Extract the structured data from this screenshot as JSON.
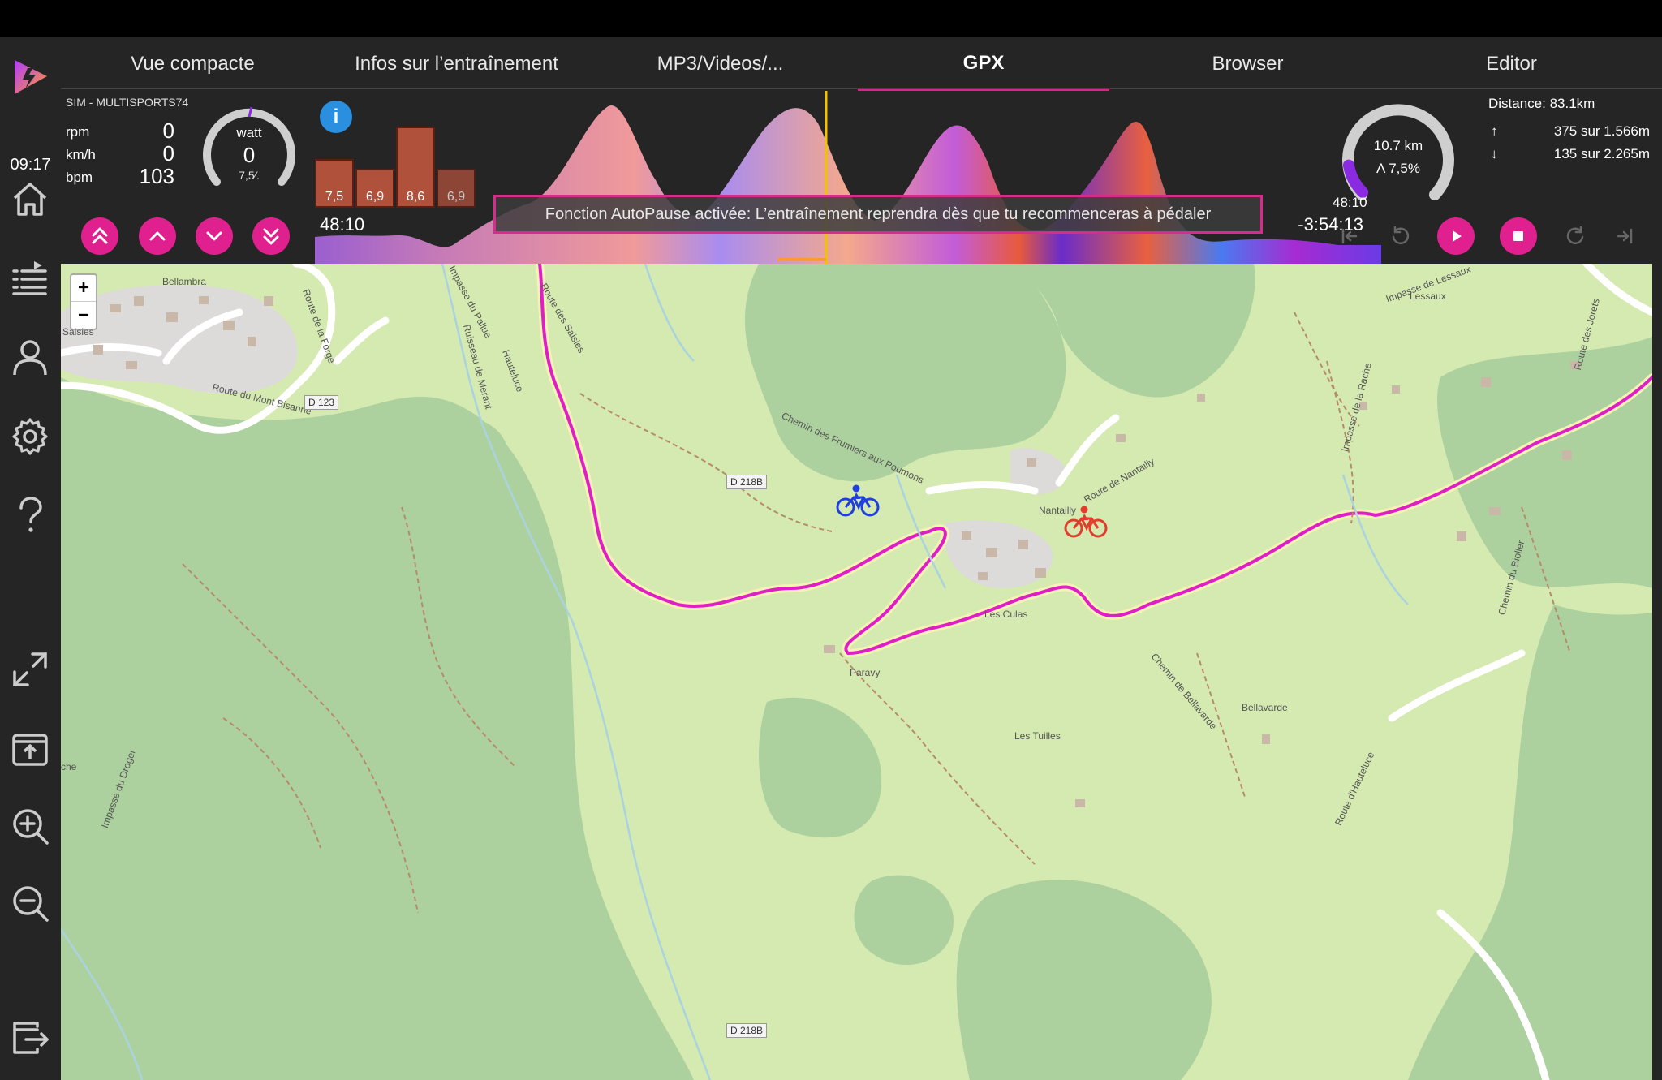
{
  "header": {
    "tabs": [
      {
        "label": "Vue compacte"
      },
      {
        "label": "Infos sur l’entraînement"
      },
      {
        "label": "MP3/Videos/..."
      },
      {
        "label": "GPX",
        "active": true
      },
      {
        "label": "Browser"
      },
      {
        "label": "Editor"
      }
    ]
  },
  "sidebar": {
    "time": "09:17",
    "icons": [
      "home-icon",
      "playlist-icon",
      "user-icon",
      "settings-icon",
      "help-icon",
      "expand-icon",
      "upload-icon",
      "zoom-in-icon",
      "zoom-out-icon",
      "exit-icon"
    ]
  },
  "metrics": {
    "device": "SIM - MULTISPORTS74",
    "rpm_label": "rpm",
    "rpm": "0",
    "kmh_label": "km/h",
    "kmh": "0",
    "bpm_label": "bpm",
    "bpm": "103",
    "watt_label": "watt",
    "watt": "0",
    "slope": "7,5⁄."
  },
  "elevation": {
    "elapsed": "48:10",
    "remaining": "-3:54:13",
    "bar_values": [
      "7,5",
      "6,9",
      "8,6",
      "6,9"
    ],
    "bar_levels": [
      0.6,
      0.48,
      1.0,
      0.48
    ],
    "info_label": "i"
  },
  "autopause_message": "Fonction AutoPause activée: L’entraînement reprendra dès que tu recommenceras à pédaler",
  "progress": {
    "distance_ring": "10.7 km",
    "slope_ring": "Λ 7,5%",
    "ring_fraction": 0.13,
    "time": "48:10",
    "distance": "Distance: 83.1km",
    "ascent_arrow": "↑",
    "ascent": "375 sur 1.566m",
    "descent_arrow": "↓",
    "descent": "135 sur 2.265m"
  },
  "map": {
    "zoom_in": "+",
    "zoom_out": "−",
    "labels": {
      "bellambra": "Bellambra",
      "saisies": "Saisies",
      "route_mont_bisanne": "Route du Mont Bisanne",
      "d123": "D 123",
      "route_forge": "Route de la Forge",
      "impasse_pallue": "Impasse du Pallue",
      "route_saisies": "Route des Saisies",
      "d218b": "D 218B",
      "d218b_2": "D 218B",
      "nantailly": "Nantailly",
      "route_nantailly": "Route de Nantailly",
      "chemin_frumiers": "Chemin des Frumiers aux Poumons",
      "les_culas": "Les Culas",
      "paravy": "Paravy",
      "bellavarde": "Bellavarde",
      "les_tuilles": "Les Tuilles",
      "lessaux": "Lessaux",
      "impasse_lessaux": "Impasse de Lessaux",
      "route_jorets": "Route des Jorets",
      "impasse_rache": "Impasse de la Rache",
      "chemin_bellavarde": "Chemin de Bellavarde",
      "route_hauteluce": "Route d'Hauteluce",
      "hauteluce": "Hauteluce",
      "ruisseau_merant": "Ruisseau de Merant",
      "impasse_droger": "Impasse du Droger",
      "chemin_bioller": "Chemin du Bioller",
      "che": "che"
    }
  },
  "colors": {
    "accent": "#e0208f",
    "panel": "#252525",
    "route": "#e01ec8",
    "rider_you": "#1f3fe0",
    "rider_ghost": "#e53b2c",
    "ring": "#8a2be2"
  }
}
